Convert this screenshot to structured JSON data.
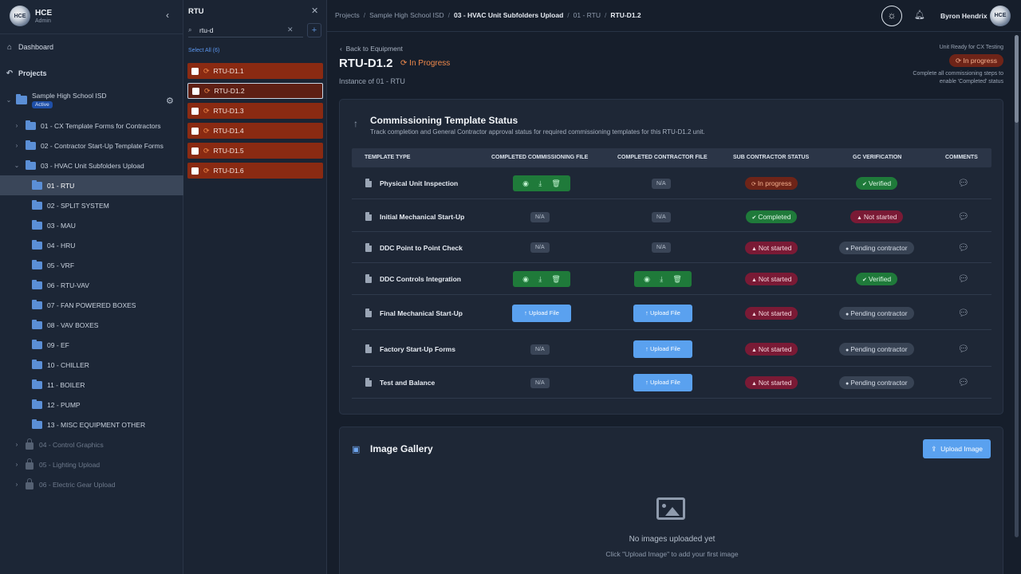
{
  "brand": {
    "logo_text": "HCE",
    "name": "HCE",
    "role": "Admin"
  },
  "nav": {
    "dashboard": "Dashboard",
    "projects": "Projects"
  },
  "project": {
    "name": "Sample High School ISD",
    "badge": "Active"
  },
  "tree": [
    {
      "label": "01 - CX Template Forms for Contractors",
      "level": 1,
      "state": "collapsed"
    },
    {
      "label": "02 - Contractor Start-Up Template Forms",
      "level": 1,
      "state": "collapsed"
    },
    {
      "label": "03 - HVAC Unit Subfolders Upload",
      "level": 1,
      "state": "expanded"
    },
    {
      "label": "01 - RTU",
      "level": 2,
      "state": "active"
    },
    {
      "label": "02 - SPLIT SYSTEM",
      "level": 2,
      "state": "normal"
    },
    {
      "label": "03 - MAU",
      "level": 2,
      "state": "normal"
    },
    {
      "label": "04 - HRU",
      "level": 2,
      "state": "normal"
    },
    {
      "label": "05 - VRF",
      "level": 2,
      "state": "normal"
    },
    {
      "label": "06 - RTU-VAV",
      "level": 2,
      "state": "normal"
    },
    {
      "label": "07 - FAN POWERED BOXES",
      "level": 2,
      "state": "normal"
    },
    {
      "label": "08 - VAV BOXES",
      "level": 2,
      "state": "normal"
    },
    {
      "label": "09 - EF",
      "level": 2,
      "state": "normal"
    },
    {
      "label": "10 - CHILLER",
      "level": 2,
      "state": "normal"
    },
    {
      "label": "11 - BOILER",
      "level": 2,
      "state": "normal"
    },
    {
      "label": "12 - PUMP",
      "level": 2,
      "state": "normal"
    },
    {
      "label": "13 - MISC EQUIPMENT OTHER",
      "level": 2,
      "state": "normal"
    },
    {
      "label": "04 - Control Graphics",
      "level": 1,
      "state": "locked"
    },
    {
      "label": "05 - Lighting Upload",
      "level": 1,
      "state": "locked"
    },
    {
      "label": "06 - Electric Gear Upload",
      "level": 1,
      "state": "locked"
    }
  ],
  "equipment_panel": {
    "title": "RTU",
    "search_value": "rtu-d",
    "select_all": "Select All (6)",
    "items": [
      "RTU-D1.1",
      "RTU-D1.2",
      "RTU-D1.3",
      "RTU-D1.4",
      "RTU-D1.5",
      "RTU-D1.6"
    ],
    "selected_item": "RTU-D1.2"
  },
  "breadcrumb": [
    "Projects",
    "Sample High School ISD",
    "03 - HVAC Unit Subfolders Upload",
    "01 - RTU",
    "RTU-D1.2"
  ],
  "user": {
    "name": "Byron Hendrix",
    "avatar_text": "HCE"
  },
  "unit": {
    "back_label": "Back to Equipment",
    "title": "RTU-D1.2",
    "status": "In Progress",
    "instance_of": "Instance of 01 - RTU",
    "ready_label": "Unit Ready for CX Testing",
    "ready_status": "In progress",
    "ready_note": "Complete all commissioning steps to enable 'Completed' status"
  },
  "cts": {
    "title": "Commissioning Template Status",
    "subtitle": "Track completion and General Contractor approval status for required commissioning templates for this RTU-D1.2 unit.",
    "columns": [
      "TEMPLATE TYPE",
      "COMPLETED COMMISSIONING FILE",
      "COMPLETED CONTRACTOR FILE",
      "SUB CONTRACTOR STATUS",
      "GC VERIFICATION",
      "COMMENTS"
    ],
    "rows": [
      {
        "template": "Physical Unit Inspection",
        "cx_file": "actions",
        "contractor_file": "N/A",
        "sub_status": "In progress",
        "sub_kind": "orange",
        "gc": "Verified",
        "gc_kind": "green"
      },
      {
        "template": "Initial Mechanical Start-Up",
        "cx_file": "N/A",
        "contractor_file": "N/A",
        "sub_status": "Completed",
        "sub_kind": "green",
        "gc": "Not started",
        "gc_kind": "red"
      },
      {
        "template": "DDC Point to Point Check",
        "cx_file": "N/A",
        "contractor_file": "N/A",
        "sub_status": "Not started",
        "sub_kind": "red",
        "gc": "Pending contractor",
        "gc_kind": "gray"
      },
      {
        "template": "DDC Controls Integration",
        "cx_file": "actions",
        "contractor_file": "actions",
        "sub_status": "Not started",
        "sub_kind": "red",
        "gc": "Verified",
        "gc_kind": "green"
      },
      {
        "template": "Final Mechanical Start-Up",
        "cx_file": "upload",
        "contractor_file": "upload",
        "sub_status": "Not started",
        "sub_kind": "red",
        "gc": "Pending contractor",
        "gc_kind": "gray"
      },
      {
        "template": "Factory Start-Up Forms",
        "cx_file": "N/A",
        "contractor_file": "upload",
        "sub_status": "Not started",
        "sub_kind": "red",
        "gc": "Pending contractor",
        "gc_kind": "gray"
      },
      {
        "template": "Test and Balance",
        "cx_file": "N/A",
        "contractor_file": "upload",
        "sub_status": "Not started",
        "sub_kind": "red",
        "gc": "Pending contractor",
        "gc_kind": "gray"
      }
    ],
    "na_label": "N/A",
    "upload_label": "Upload File"
  },
  "gallery": {
    "title": "Image Gallery",
    "upload_label": "Upload Image",
    "empty_title": "No images uploaded yet",
    "empty_hint": "Click \"Upload Image\" to add your first image"
  },
  "colors": {
    "accent": "#5aa1ef",
    "in_progress": "#f08a4b",
    "danger": "#7a1a35",
    "success": "#1f7a3a"
  }
}
